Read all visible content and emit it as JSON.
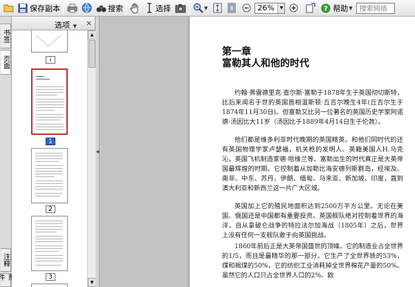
{
  "toolbar": {
    "save_copy": "保存副本",
    "search": "搜索",
    "select": "选择",
    "zoom_value": "26%",
    "help": "帮助",
    "search_placeholder": "搜索网络"
  },
  "side_tabs": {
    "bookmarks": "书签",
    "pages": "页面",
    "annotations": "注释",
    "attachments": "附件"
  },
  "panel": {
    "options": "选项",
    "close": "×",
    "pages": [
      {
        "label": "i"
      },
      {
        "label": "1",
        "selected": true
      },
      {
        "label": "2"
      },
      {
        "label": "3"
      }
    ]
  },
  "document": {
    "chapter": "第一章",
    "title": "富勒其人和他的时代",
    "paragraphs": [
      "约翰·弗雷德里克·查尔斯·富勒于1878年生于英国彻切斯特，比后来闻名于世的英国首相温斯顿·丘吉尔晚生4年(丘吉尔生于1874年11月30日)。但富勒又比另一位著名的英国历史学家阿诺德·汤因比大11岁（汤因比于1889年4月14日生于伦敦）。",
      "他们都是维多利亚时代晚期的英国精英。和他们同时代的还有英国物理学家卢瑟福，机关枪的发明人、英籍美国人H.马克沁，英国飞机制造家德·哈维兰等。富勒出生的时代真正是大英帝国最辉煌的时期。它控制着从加勒比海安德列斯群岛，经埃及、南非、中东、苏丹、伊朗、缅甸、马来亚、新加坡、印度，直到澳大利亚和新西兰这一片广大区域。",
      "英国加上它的殖民地面积达到2500万平方公里。无论在美国、俄国还是中国都有重要投资。英国舰队绝对控制着世界的海洋，自从拿破仑战争的特拉法尔加海战（1805年）之后，世界上没有任何一支舰队敢于向英国挑战。",
      "1860年前后正是大英帝国盛世的顶峰。它的制造业占全世界的1/5，而且是最精华的那一部分。它生产了全世界铁的53%，煤和褐煤的50%，它的纺织工业消耗掉全世界棉花产量的50%。虽然它的人口只占全世界人口的2%、欧"
    ]
  }
}
